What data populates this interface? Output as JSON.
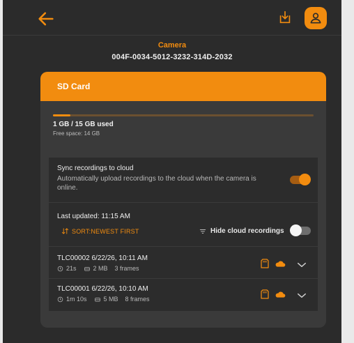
{
  "header": {
    "back_icon": "arrow-left-icon",
    "download_icon": "download-icon",
    "account_icon": "user-icon",
    "accent": "#f28c0f"
  },
  "camera": {
    "label": "Camera",
    "id": "004F-0034-5012-3232-314D-2032"
  },
  "sd_card": {
    "title": "SD Card",
    "used_fraction": 0.067,
    "used_text": "1 GB / 15 GB used",
    "free_text": "Free space: 14 GB"
  },
  "sync": {
    "title": "Sync recordings to cloud",
    "description": "Automatically upload recordings to the cloud when the camera is online.",
    "enabled": true
  },
  "recordings": {
    "last_updated": "Last updated: 11:15 AM",
    "sort_label": "SORT:NEWEST FIRST",
    "hide_cloud_label": "Hide cloud recordings",
    "hide_cloud_enabled": false,
    "items": [
      {
        "title": "TLC00002  6/22/26, 10:11 AM",
        "duration": "21s",
        "size": "2 MB",
        "frames": "3 frames"
      },
      {
        "title": "TLC00001  6/22/26, 10:10 AM",
        "duration": "1m 10s",
        "size": "5 MB",
        "frames": "8 frames"
      }
    ]
  }
}
